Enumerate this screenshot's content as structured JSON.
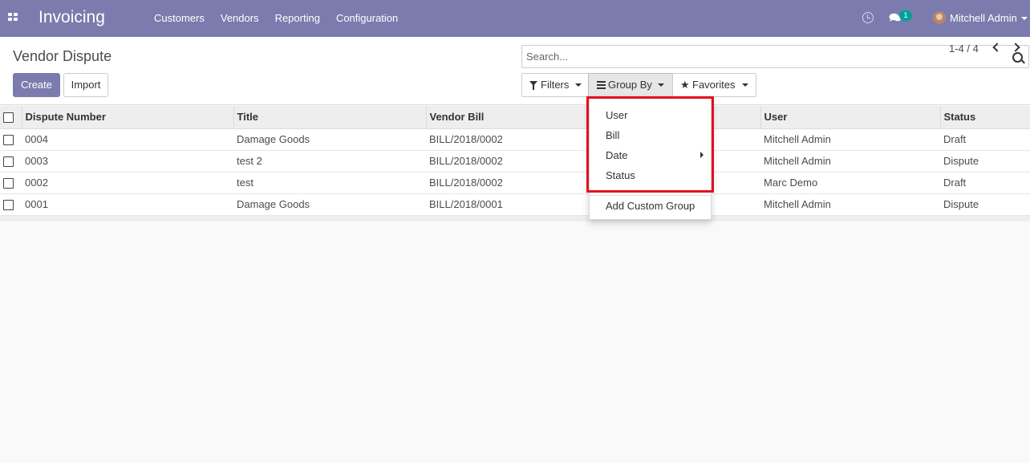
{
  "navbar": {
    "app_title": "Invoicing",
    "menu": [
      "Customers",
      "Vendors",
      "Reporting",
      "Configuration"
    ],
    "chat_badge": "1",
    "user_name": "Mitchell Admin",
    "color": "#7c7bad"
  },
  "control_panel": {
    "title": "Vendor Dispute",
    "create_label": "Create",
    "import_label": "Import",
    "search_placeholder": "Search...",
    "filters_label": "Filters",
    "group_by_label": "Group By",
    "favorites_label": "Favorites",
    "pager": "1-4 / 4"
  },
  "table": {
    "columns": [
      "Dispute Number",
      "Title",
      "Vendor Bill",
      "",
      "User",
      "Status"
    ],
    "rows": [
      {
        "number": "0004",
        "title": "Damage Goods",
        "bill": "BILL/2018/0002",
        "user": "Mitchell Admin",
        "status": "Draft"
      },
      {
        "number": "0003",
        "title": "test 2",
        "bill": "BILL/2018/0002",
        "user": "Mitchell Admin",
        "status": "Dispute"
      },
      {
        "number": "0002",
        "title": "test",
        "bill": "BILL/2018/0002",
        "user": "Marc Demo",
        "status": "Draft"
      },
      {
        "number": "0001",
        "title": "Damage Goods",
        "bill": "BILL/2018/0001",
        "user": "Mitchell Admin",
        "status": "Dispute"
      }
    ]
  },
  "group_by_dropdown": {
    "items": [
      "User",
      "Bill",
      "Date",
      "Status"
    ],
    "custom_group": "Add Custom Group",
    "highlight_color": "#e3101f"
  }
}
